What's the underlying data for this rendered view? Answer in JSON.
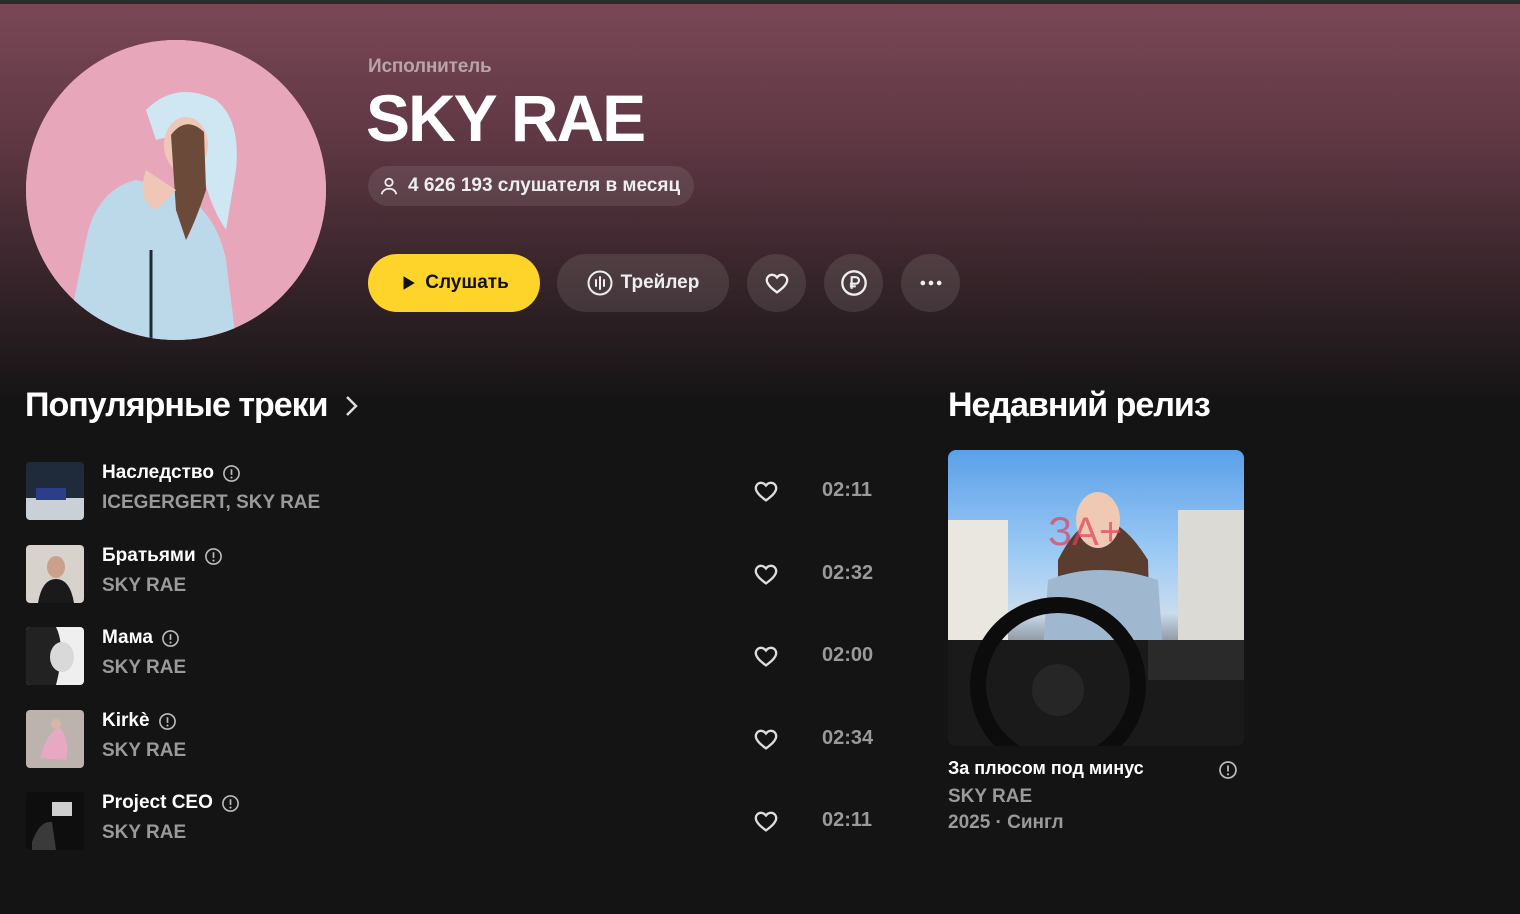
{
  "artist": {
    "type_label": "Исполнитель",
    "name": "SKY RAE",
    "listeners": "4 626 193 слушателя в месяц"
  },
  "actions": {
    "play_label": "Слушать",
    "trailer_label": "Трейлер",
    "like_icon": "heart-icon",
    "donate_icon": "ruble-icon",
    "more_icon": "more-icon"
  },
  "popular": {
    "title": "Популярные треки",
    "tracks": [
      {
        "name": "Наследство",
        "artists": "ICEGERGERT, SKY RAE",
        "duration": "02:11"
      },
      {
        "name": "Братьями",
        "artists": "SKY RAE",
        "duration": "02:32"
      },
      {
        "name": "Мама",
        "artists": "SKY RAE",
        "duration": "02:00"
      },
      {
        "name": "Kirkè",
        "artists": "SKY RAE",
        "duration": "02:34"
      },
      {
        "name": "Project CEO",
        "artists": "SKY RAE",
        "duration": "02:11"
      }
    ]
  },
  "recent": {
    "title": "Недавний релиз",
    "release_name": "За плюсом под минус",
    "release_artist": "SKY RAE",
    "release_meta": "2025 · Сингл"
  },
  "colors": {
    "accent": "#fed42b",
    "hero_top": "#7a4755",
    "background": "#141414"
  }
}
